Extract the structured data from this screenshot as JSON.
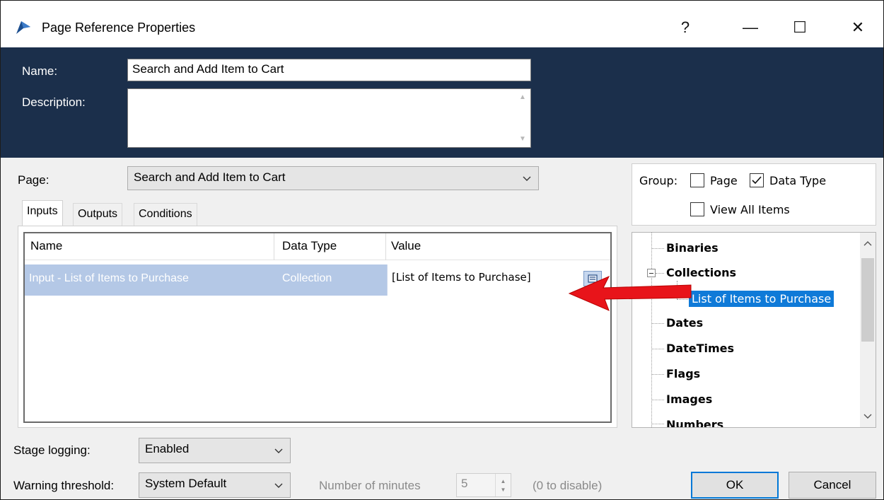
{
  "window": {
    "title": "Page Reference Properties",
    "help_glyph": "?",
    "minimize_glyph": "—",
    "maximize_glyph": "☐",
    "close_glyph": "✕"
  },
  "header": {
    "name_label": "Name:",
    "name_value": "Search and Add Item to Cart",
    "description_label": "Description:",
    "description_value": ""
  },
  "page": {
    "label": "Page:",
    "selected": "Search and Add Item to Cart"
  },
  "tabs": [
    {
      "label": "Inputs",
      "active": true
    },
    {
      "label": "Outputs",
      "active": false
    },
    {
      "label": "Conditions",
      "active": false
    }
  ],
  "grid": {
    "columns": [
      "Name",
      "Data Type",
      "Value"
    ],
    "rows": [
      {
        "name": "Input - List of Items to Purchase",
        "data_type": "Collection",
        "value": "[List of Items to Purchase]"
      }
    ]
  },
  "group": {
    "label": "Group:",
    "page_option": {
      "label": "Page",
      "checked": false
    },
    "data_type_option": {
      "label": "Data Type",
      "checked": true
    },
    "view_all_option": {
      "label": "View All Items",
      "checked": false
    }
  },
  "tree": {
    "items": [
      {
        "label": "Binaries",
        "level": 0
      },
      {
        "label": "Collections",
        "level": 0,
        "expanded": true
      },
      {
        "label": "List of Items to Purchase",
        "level": 1,
        "selected": true
      },
      {
        "label": "Dates",
        "level": 0
      },
      {
        "label": "DateTimes",
        "level": 0
      },
      {
        "label": "Flags",
        "level": 0
      },
      {
        "label": "Images",
        "level": 0
      },
      {
        "label": "Numbers",
        "level": 0
      }
    ]
  },
  "bottom": {
    "stage_logging_label": "Stage logging:",
    "stage_logging_value": "Enabled",
    "warning_label": "Warning threshold:",
    "warning_value": "System Default",
    "minutes_label": "Number of minutes",
    "minutes_value": "5",
    "disable_hint": "(0 to disable)",
    "ok_label": "OK",
    "cancel_label": "Cancel"
  },
  "colors": {
    "header_bg": "#1b2f4b",
    "selection_row": "#b4c8e6",
    "tree_selection": "#0f7ad8",
    "annotation_arrow": "#e8141a"
  }
}
